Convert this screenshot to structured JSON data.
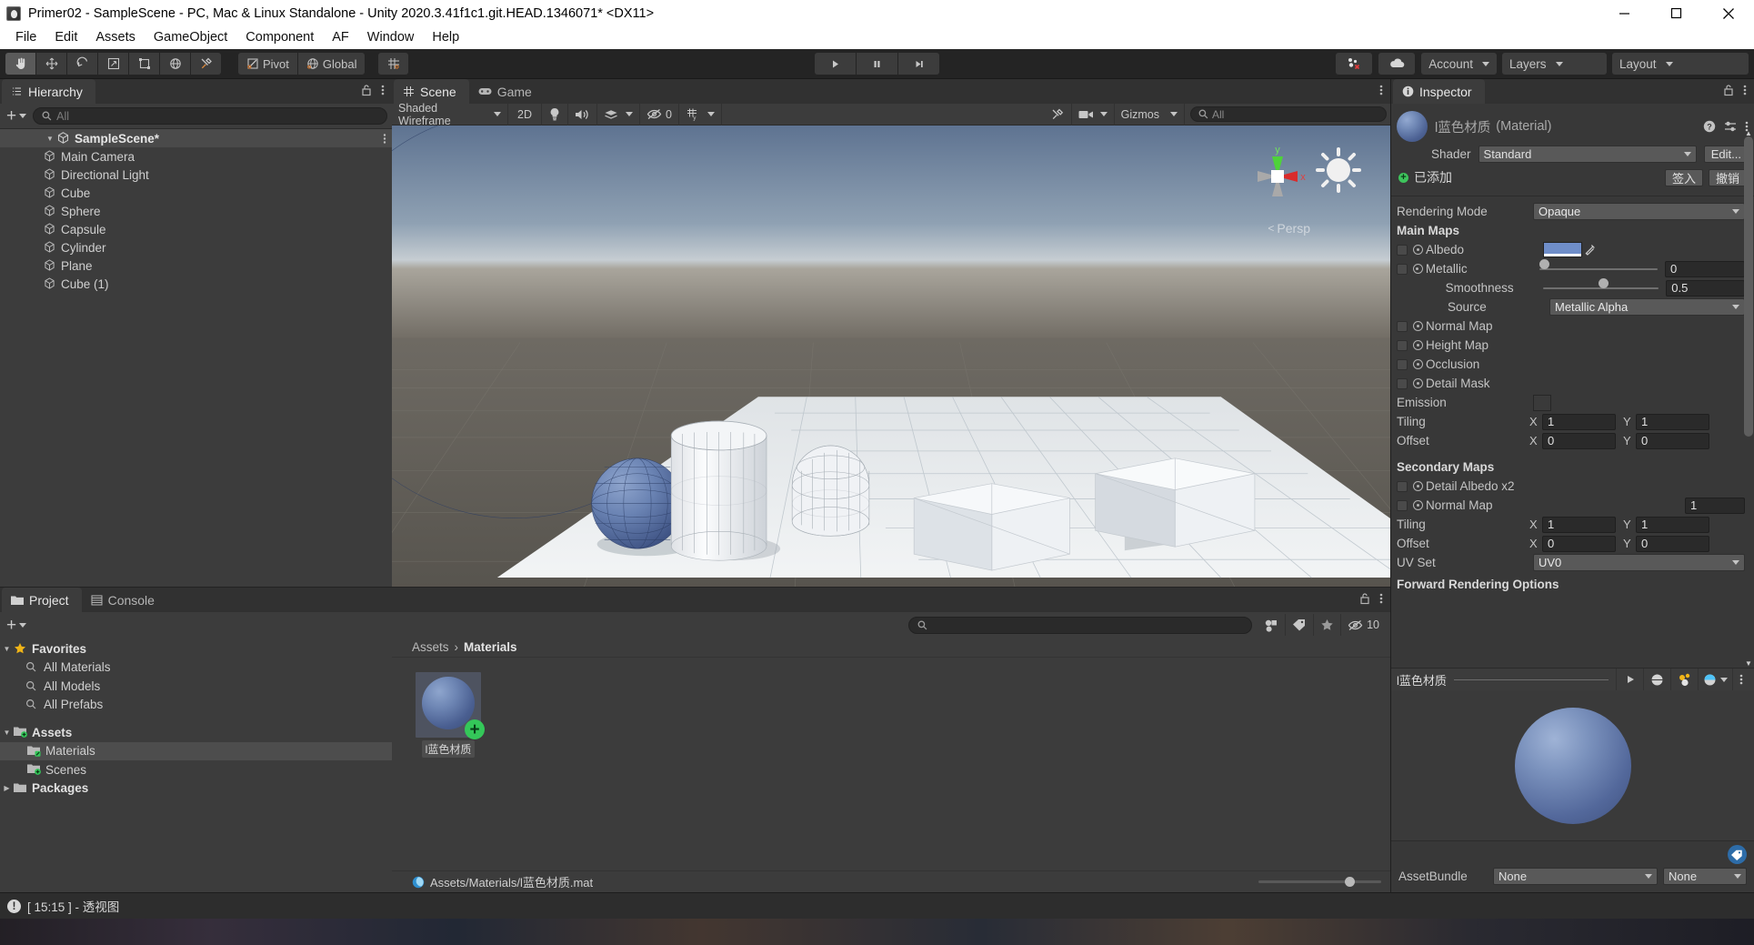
{
  "window": {
    "title": "Primer02 - SampleScene - PC, Mac & Linux Standalone - Unity 2020.3.41f1c1.git.HEAD.1346071* <DX11>",
    "minimize": "minimize-icon",
    "maximize": "maximize-icon",
    "close": "close-icon"
  },
  "menubar": {
    "items": [
      "File",
      "Edit",
      "Assets",
      "GameObject",
      "Component",
      "AF",
      "Window",
      "Help"
    ]
  },
  "toolbar": {
    "tools": [
      "hand-tool",
      "move-tool",
      "rotate-tool",
      "scale-tool",
      "rect-tool",
      "transform-tool",
      "custom-tool"
    ],
    "pivot_label": "Pivot",
    "global_label": "Global",
    "grid_label": "grid-snap-icon",
    "play_label": "play-icon",
    "pause_label": "pause-icon",
    "step_label": "step-icon",
    "collab_label": "collab-icon",
    "cloud_label": "cloud-icon",
    "account_label": "Account",
    "layers_label": "Layers",
    "layout_label": "Layout"
  },
  "hierarchy": {
    "tab": "Hierarchy",
    "search_placeholder": "All",
    "scene_name": "SampleScene*",
    "items": [
      {
        "label": "Main Camera"
      },
      {
        "label": "Directional Light"
      },
      {
        "label": "Cube"
      },
      {
        "label": "Sphere"
      },
      {
        "label": "Capsule"
      },
      {
        "label": "Cylinder"
      },
      {
        "label": "Plane"
      },
      {
        "label": "Cube (1)"
      }
    ]
  },
  "scene": {
    "tabs": [
      {
        "label": "Scene",
        "active": true
      },
      {
        "label": "Game",
        "active": false
      }
    ],
    "shading_mode": "Shaded Wireframe",
    "twod_label": "2D",
    "lighting_label": "lighting-icon",
    "audio_label": "audio-icon",
    "fx_label": "effects-icon",
    "hidden_count": "0",
    "grid_label": "grid-icon",
    "tools_label": "tools-icon",
    "camera_label": "camera-icon",
    "gizmos_label": "Gizmos",
    "search_placeholder": "All",
    "gizmo_axes": {
      "y": "y",
      "x": "x"
    },
    "perspective_label": "Persp"
  },
  "project": {
    "tabs": [
      {
        "label": "Project",
        "active": true
      },
      {
        "label": "Console",
        "active": false
      }
    ],
    "favorites_label": "Favorites",
    "favorites": [
      {
        "label": "All Materials"
      },
      {
        "label": "All Models"
      },
      {
        "label": "All Prefabs"
      }
    ],
    "assets_label": "Assets",
    "folders": [
      {
        "label": "Materials",
        "selected": true
      },
      {
        "label": "Scenes",
        "selected": false
      }
    ],
    "packages_label": "Packages",
    "search_placeholder": "",
    "hidden_count": "10",
    "breadcrumb_root": "Assets",
    "breadcrumb_current": "Materials",
    "assets": [
      {
        "label": "l蓝色材质",
        "badge": "added-badge"
      }
    ],
    "footer_path": "Assets/Materials/l蓝色材质.mat"
  },
  "inspector": {
    "tab": "Inspector",
    "material_name": "l蓝色材质",
    "material_type": "(Material)",
    "shader_label": "Shader",
    "shader_value": "Standard",
    "edit_label": "Edit...",
    "added_label": "已添加",
    "checkin_label": "签入",
    "revert_label": "撤销",
    "rendering_mode_label": "Rendering Mode",
    "rendering_mode_value": "Opaque",
    "main_maps_label": "Main Maps",
    "albedo_label": "Albedo",
    "albedo_color": "#6f8ec9",
    "metallic_label": "Metallic",
    "metallic_value": "0",
    "smoothness_label": "Smoothness",
    "smoothness_value": "0.5",
    "source_label": "Source",
    "source_value": "Metallic Alpha",
    "normal_map_label": "Normal Map",
    "height_map_label": "Height Map",
    "occlusion_label": "Occlusion",
    "detail_mask_label": "Detail Mask",
    "emission_label": "Emission",
    "tiling_label": "Tiling",
    "tiling_x": "1",
    "tiling_y": "1",
    "offset_label": "Offset",
    "offset_x": "0",
    "offset_y": "0",
    "secondary_maps_label": "Secondary Maps",
    "detail_albedo_label": "Detail Albedo x2",
    "secondary_normal_label": "Normal Map",
    "secondary_normal_value": "1",
    "secondary_tiling_label": "Tiling",
    "secondary_tiling_x": "1",
    "secondary_tiling_y": "1",
    "secondary_offset_label": "Offset",
    "secondary_offset_x": "0",
    "secondary_offset_y": "0",
    "uv_set_label": "UV Set",
    "uv_set_value": "UV0",
    "forward_rendering_label": "Forward Rendering Options",
    "x_label": "X",
    "y_label": "Y"
  },
  "preview": {
    "title": "l蓝色材质",
    "play_icon": "play-icon",
    "sphere_icon": "sphere-preview-icon",
    "light_icon": "lighting-preview-icon",
    "mode_icon": "render-mode-icon",
    "menu_icon": "kebab-icon"
  },
  "assetbundle": {
    "label": "AssetBundle",
    "value": "None",
    "variant": "None"
  },
  "statusbar": {
    "message": "[ 15:15 ] - 透视图"
  },
  "colors": {
    "accent_blue": "#6f8ec9",
    "green_badge": "#34c759",
    "panel_bg": "#3c3c3c",
    "inspector_bg": "#383838"
  }
}
